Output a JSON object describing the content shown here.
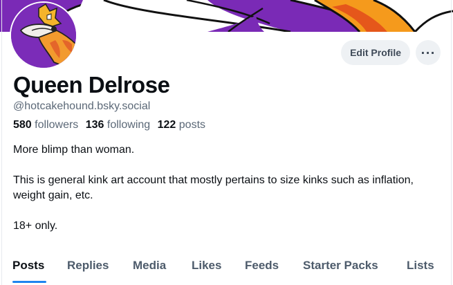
{
  "profile": {
    "display_name": "Queen Delrose",
    "handle": "@hotcakehound.bsky.social",
    "followers_count": "580",
    "followers_label": "followers",
    "following_count": "136",
    "following_label": "following",
    "posts_count": "122",
    "posts_label": "posts",
    "bio": {
      "line1": "More blimp than woman.",
      "line2": "This is general kink art account that mostly pertains to size kinks such as inflation, weight gain, etc.",
      "line3": "18+ only."
    }
  },
  "actions": {
    "edit_profile_label": "Edit Profile",
    "more_label": "···",
    "more_icon": "ellipsis-icon"
  },
  "tabs": [
    {
      "label": "Posts",
      "active": true
    },
    {
      "label": "Replies"
    },
    {
      "label": "Media"
    },
    {
      "label": "Likes"
    },
    {
      "label": "Feeds"
    },
    {
      "label": "Starter Packs"
    },
    {
      "label": "Lists"
    }
  ],
  "colors": {
    "banner_purple": "#7a2ab6",
    "accent_blue": "#1d84f0",
    "button_bg": "#eef1f4",
    "muted_text": "#5b6877"
  }
}
